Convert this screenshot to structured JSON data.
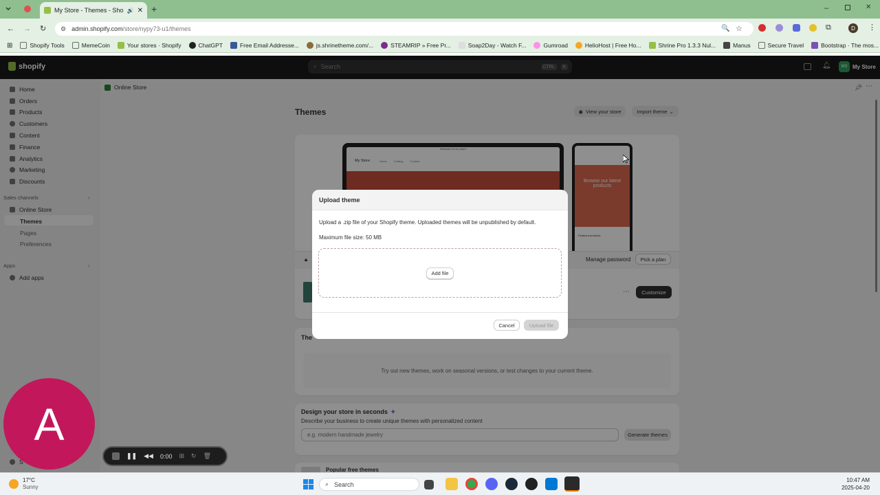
{
  "browser": {
    "tab_title": "My Store - Themes - Shopify",
    "url_host": "admin.shopify.com",
    "url_path": "/store/nypy73-u1/themes",
    "profile_initial": "D",
    "bookmarks": [
      {
        "label": "Shopify Tools",
        "color": "#6d6d6d"
      },
      {
        "label": "MemeCoin",
        "color": "#6d6d6d"
      },
      {
        "label": "Your stores · Shopify",
        "color": "#95bf47"
      },
      {
        "label": "ChatGPT",
        "color": "#222222"
      },
      {
        "label": "Free Email Addresse...",
        "color": "#3b5998"
      },
      {
        "label": "js.shrinetheme.com/...",
        "color": "#8a6d3b"
      },
      {
        "label": "STEAMRIP » Free Pr...",
        "color": "#7b2d8b"
      },
      {
        "label": "Soap2Day - Watch F...",
        "color": "#e0e0e0"
      },
      {
        "label": "Gumroad",
        "color": "#ff90e8"
      },
      {
        "label": "HelioHost | Free Ho...",
        "color": "#f5a623"
      },
      {
        "label": "Shrine Pro 1.3.3 Nul...",
        "color": "#95bf47"
      },
      {
        "label": "Manus",
        "color": "#444444"
      },
      {
        "label": "Secure Travel",
        "color": "#6d6d6d"
      },
      {
        "label": "Bootstrap · The mos...",
        "color": "#7952b3"
      }
    ]
  },
  "shopify": {
    "logo_text": "shopify",
    "search_placeholder": "Search",
    "shortcut_key1": "CTRL",
    "shortcut_key2": "K",
    "store_badge": "MS",
    "store_name": "My Store"
  },
  "sidebar": {
    "items": [
      "Home",
      "Orders",
      "Products",
      "Customers",
      "Content",
      "Finance",
      "Analytics",
      "Marketing",
      "Discounts"
    ],
    "sales_channels_label": "Sales channels",
    "online_store": "Online Store",
    "sub_items": [
      "Themes",
      "Pages",
      "Preferences"
    ],
    "apps_label": "Apps",
    "add_apps": "Add apps",
    "settings_partial": "S"
  },
  "main": {
    "breadcrumb": "Online Store",
    "title": "Themes",
    "view_store": "View your store",
    "import_theme": "Import theme",
    "preview_announcement": "Welcome to our store",
    "preview_store_name": "My Store",
    "preview_nav": [
      "Home",
      "Catalog",
      "Contact"
    ],
    "mobile_banner": "Browse our latest products",
    "mobile_featured": "Featured products",
    "manage_password": "Manage password",
    "pick_plan": "Pick a plan",
    "customize": "Customize",
    "library_heading_partial": "The",
    "library_empty": "Try out new themes, work on seasonal versions, or test changes to your current theme.",
    "design_title": "Design your store in seconds",
    "design_desc": "Describe your business to create unique themes with personalized content",
    "design_placeholder": "e.g. modern handmade jewelry",
    "generate": "Generate themes",
    "popular_partial": "Popular free themes"
  },
  "modal": {
    "title": "Upload theme",
    "description": "Upload a .zip file of your Shopify theme. Uploaded themes will be unpublished by default.",
    "max_size": "Maximum file size: 50 MB",
    "add_file": "Add file",
    "cancel": "Cancel",
    "upload": "Upload file"
  },
  "recorder": {
    "avatar_letter": "A",
    "time": "0:00"
  },
  "taskbar": {
    "weather_temp": "17°C",
    "weather_desc": "Sunny",
    "search": "Search",
    "time": "10:47 AM",
    "date": "2025-04-20"
  }
}
